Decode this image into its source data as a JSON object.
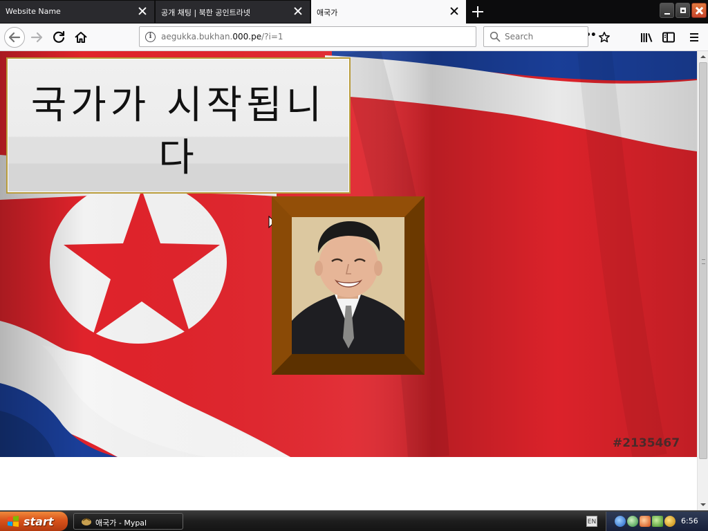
{
  "browser": {
    "tabs": [
      {
        "title": "Website Name",
        "active": false
      },
      {
        "title": "공개 채팅 | 북한 공인트라넷",
        "active": false
      },
      {
        "title": "애국가",
        "active": true
      }
    ],
    "url": {
      "prefix": "aegukka.bukhan.",
      "domain": "000.pe",
      "suffix": "/?i=1"
    },
    "page_actions_label": "•••",
    "search_placeholder": "Search"
  },
  "page": {
    "title_text": "국가가 시작됩니다",
    "watermark_id": "#2135467"
  },
  "taskbar": {
    "start_label": "start",
    "window_label": "애국가 - Mypal",
    "language": "EN",
    "clock": "6:56"
  },
  "colors": {
    "flag_red": "#e0232b",
    "flag_blue": "#1a3f9a",
    "flag_white": "#f2f2f2",
    "frame_brown": "#7a4200",
    "title_border": "#b89b3a"
  }
}
